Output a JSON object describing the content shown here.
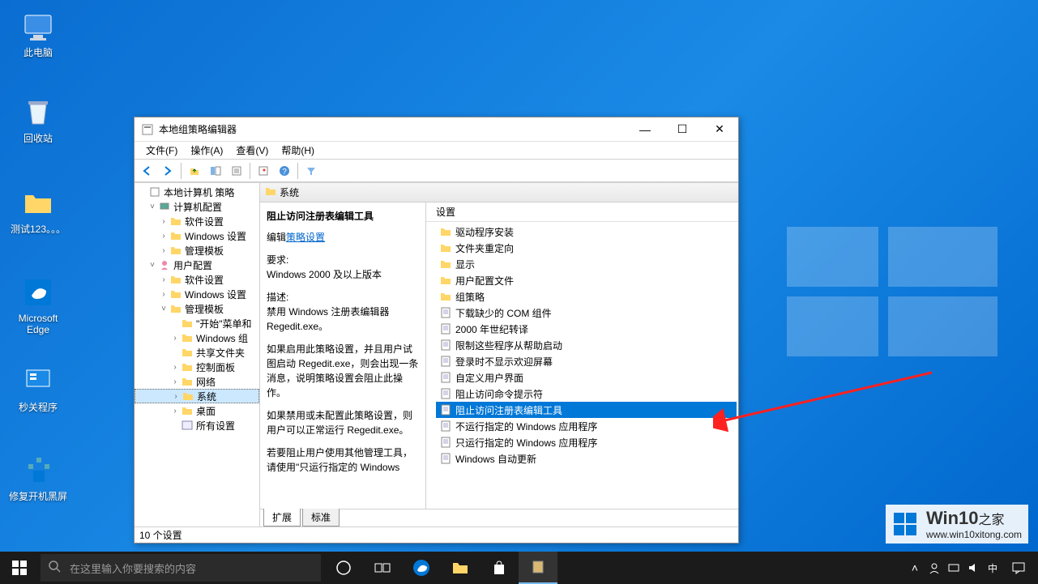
{
  "desktop": {
    "icons": [
      {
        "name": "this-pc",
        "label": "此电脑"
      },
      {
        "name": "recycle-bin",
        "label": "回收站"
      },
      {
        "name": "folder-test",
        "label": "测试123。。。"
      },
      {
        "name": "edge",
        "label": "Microsoft Edge"
      },
      {
        "name": "close-seconds",
        "label": "秒关程序"
      },
      {
        "name": "fix-boot",
        "label": "修复开机黑屏"
      }
    ]
  },
  "window": {
    "title": "本地组策略编辑器",
    "menu": {
      "file": "文件(F)",
      "action": "操作(A)",
      "view": "查看(V)",
      "help": "帮助(H)"
    },
    "tree": {
      "root": "本地计算机 策略",
      "computer_cfg": "计算机配置",
      "software": "软件设置",
      "windows": "Windows 设置",
      "admin_tpl": "管理模板",
      "user_cfg": "用户配置",
      "start_menu": "\"开始\"菜单和",
      "win_comp": "Windows 组",
      "shared": "共享文件夹",
      "control_panel": "控制面板",
      "network": "网络",
      "system": "系统",
      "desktop_n": "桌面",
      "all_settings": "所有设置"
    },
    "detail": {
      "header": "系统",
      "title": "阻止访问注册表编辑工具",
      "edit_prefix": "编辑",
      "edit_link": "策略设置",
      "req_label": "要求:",
      "req_text": "Windows 2000 及以上版本",
      "desc_label": "描述:",
      "desc1": "禁用 Windows 注册表编辑器 Regedit.exe。",
      "desc2": "如果启用此策略设置，并且用户试图启动 Regedit.exe，则会出现一条消息，说明策略设置会阻止此操作。",
      "desc3": "如果禁用或未配置此策略设置，则用户可以正常运行 Regedit.exe。",
      "desc4": "若要阻止用户使用其他管理工具，请使用\"只运行指定的 Windows",
      "settings_label": "设置"
    },
    "settings": [
      {
        "type": "folder",
        "label": "驱动程序安装"
      },
      {
        "type": "folder",
        "label": "文件夹重定向"
      },
      {
        "type": "folder",
        "label": "显示"
      },
      {
        "type": "folder",
        "label": "用户配置文件"
      },
      {
        "type": "folder",
        "label": "组策略"
      },
      {
        "type": "item",
        "label": "下载缺少的 COM 组件"
      },
      {
        "type": "item",
        "label": "2000 年世纪转译"
      },
      {
        "type": "item",
        "label": "限制这些程序从帮助启动"
      },
      {
        "type": "item",
        "label": "登录时不显示欢迎屏幕"
      },
      {
        "type": "item",
        "label": "自定义用户界面"
      },
      {
        "type": "item",
        "label": "阻止访问命令提示符"
      },
      {
        "type": "item",
        "label": "阻止访问注册表编辑工具",
        "selected": true
      },
      {
        "type": "item",
        "label": "不运行指定的 Windows 应用程序"
      },
      {
        "type": "item",
        "label": "只运行指定的 Windows 应用程序"
      },
      {
        "type": "item",
        "label": "Windows 自动更新"
      }
    ],
    "tabs": {
      "ext": "扩展",
      "std": "标准"
    },
    "status": "10 个设置"
  },
  "taskbar": {
    "search_placeholder": "在这里输入你要搜索的内容"
  },
  "watermark": {
    "brand_big": "Win10",
    "brand_suffix": "之家",
    "url": "www.win10xitong.com"
  }
}
